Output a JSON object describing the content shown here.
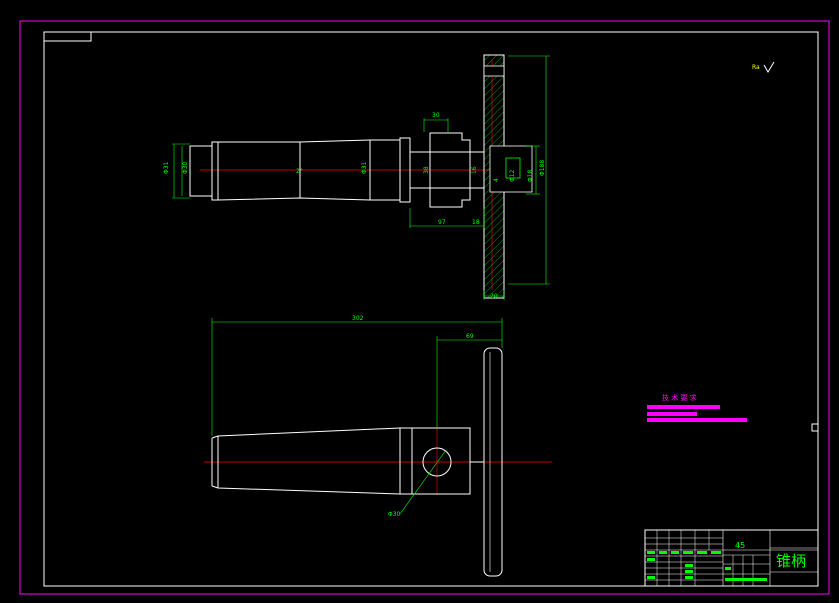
{
  "colors": {
    "background": "#000000",
    "sheet_border": "#ff00ff",
    "frame": "#ffffff",
    "outline": "#ffffff",
    "dimension": "#00ff00",
    "centerline": "#ff0000",
    "notes": "#ff00ff",
    "hatch": "#00ff00"
  },
  "top_view": {
    "dims": {
      "left_dia_a": "Φ31",
      "left_dia_b": "Φ30",
      "mid_label": "2°",
      "dia_mid": "Φ31",
      "top_30": "30",
      "inner_38": "38",
      "small_16": "16",
      "bot_97": "97",
      "bot_18": "18",
      "hub_dia1": "Φ12",
      "hub_dia2": "Φ18",
      "outer_dia": "Φ188",
      "bottom_20": "20",
      "small_4": "4"
    }
  },
  "front_view": {
    "dims": {
      "overall_length": "302",
      "right_69": "69",
      "hole_dia": "Φ30"
    }
  },
  "roughness_symbol": "Ra",
  "tech_notes": {
    "title": "技 术 要 求"
  },
  "title_block": {
    "part_name": "锥柄",
    "material": "45"
  }
}
